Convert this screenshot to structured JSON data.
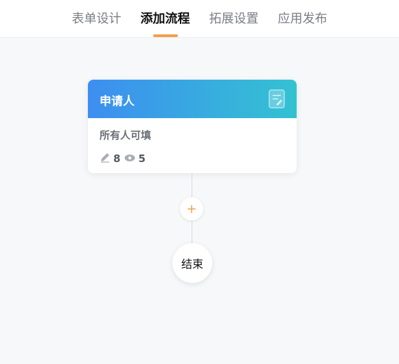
{
  "tabs": [
    {
      "label": "表单设计",
      "active": false
    },
    {
      "label": "添加流程",
      "active": true
    },
    {
      "label": "拓展设置",
      "active": false
    },
    {
      "label": "应用发布",
      "active": false
    }
  ],
  "accent_color": "#f0a04b",
  "flow": {
    "start_node": {
      "title": "申请人",
      "header_colors": [
        "#3d8ef0",
        "#33c2d2"
      ],
      "description": "所有人可填",
      "edit_count": "8",
      "view_count": "5",
      "header_icon": "form-edit-icon",
      "edit_icon": "pencil-icon",
      "view_icon": "eye-icon"
    },
    "add_button": {
      "symbol": "+"
    },
    "end_node": {
      "label": "结束"
    }
  }
}
